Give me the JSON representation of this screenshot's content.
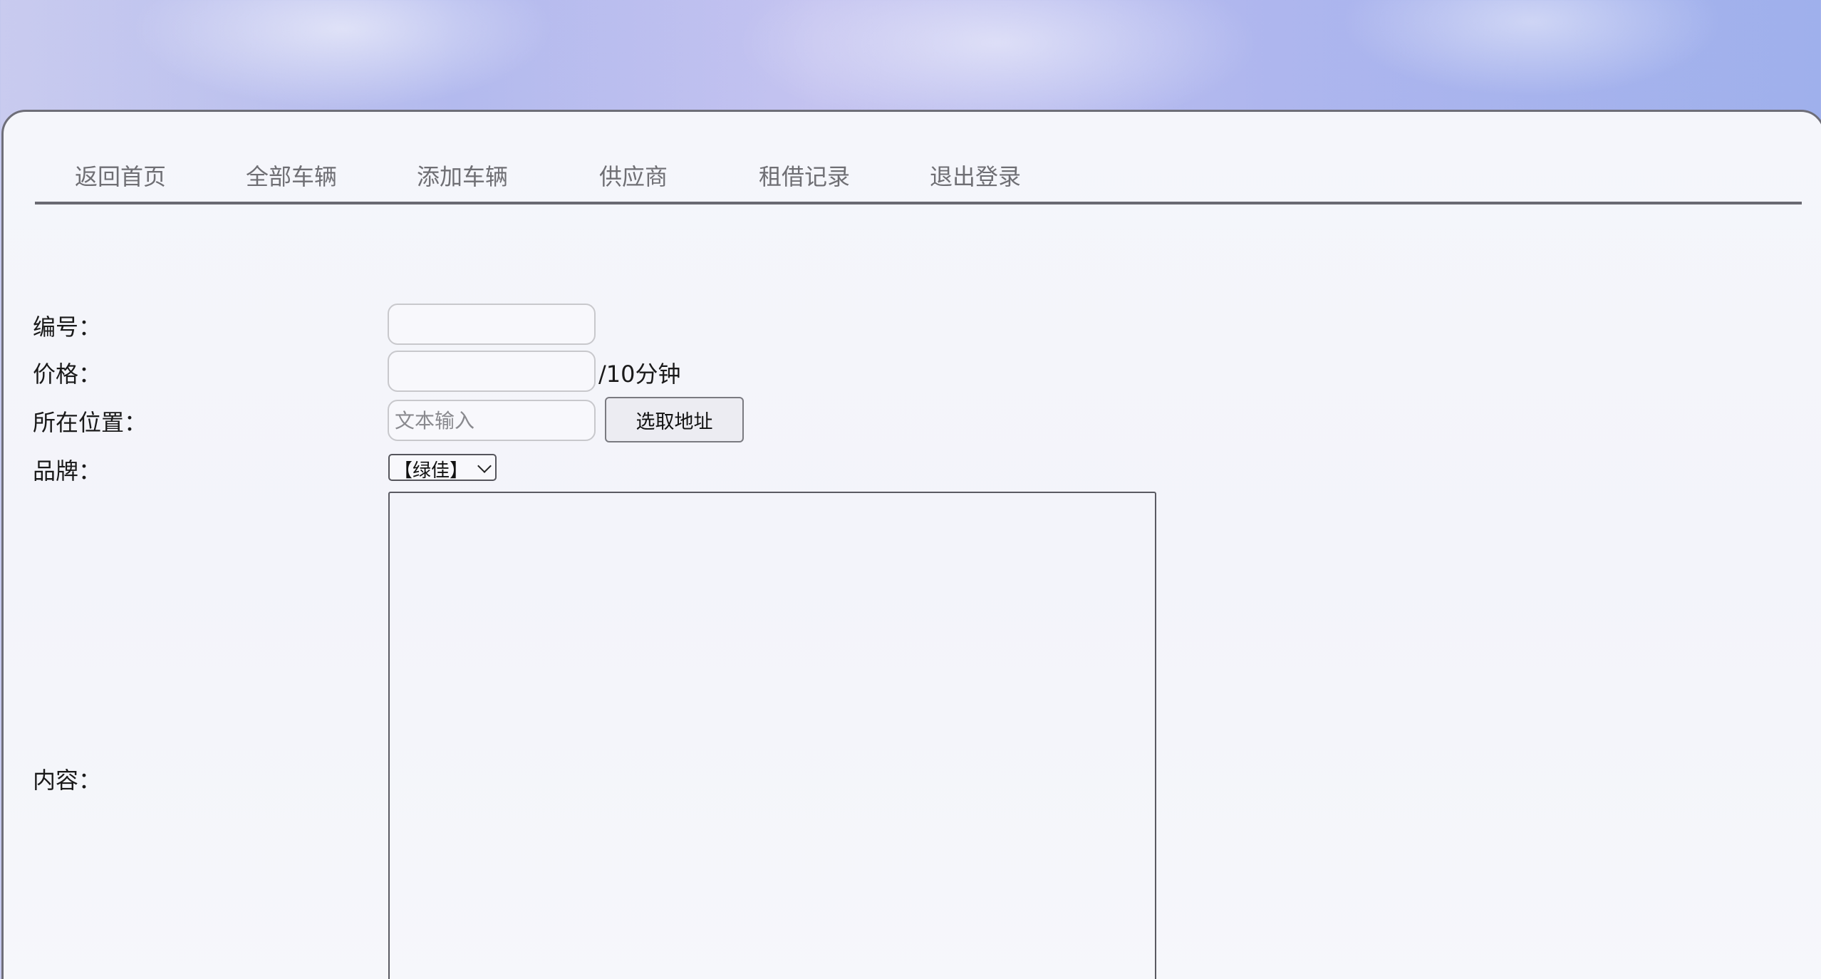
{
  "nav": {
    "items": [
      {
        "label": "返回首页"
      },
      {
        "label": "全部车辆"
      },
      {
        "label": "添加车辆"
      },
      {
        "label": "供应商"
      },
      {
        "label": "租借记录"
      },
      {
        "label": "退出登录"
      }
    ]
  },
  "form": {
    "id": {
      "label": "编号：",
      "value": ""
    },
    "price": {
      "label": "价格：",
      "value": "",
      "unit": "/10分钟"
    },
    "location": {
      "label": "所在位置：",
      "value": "",
      "placeholder": "文本输入",
      "pick_label": "选取地址"
    },
    "brand": {
      "label": "品牌：",
      "selected": "【绿佳】"
    },
    "content": {
      "label": "内容：",
      "value": ""
    }
  }
}
